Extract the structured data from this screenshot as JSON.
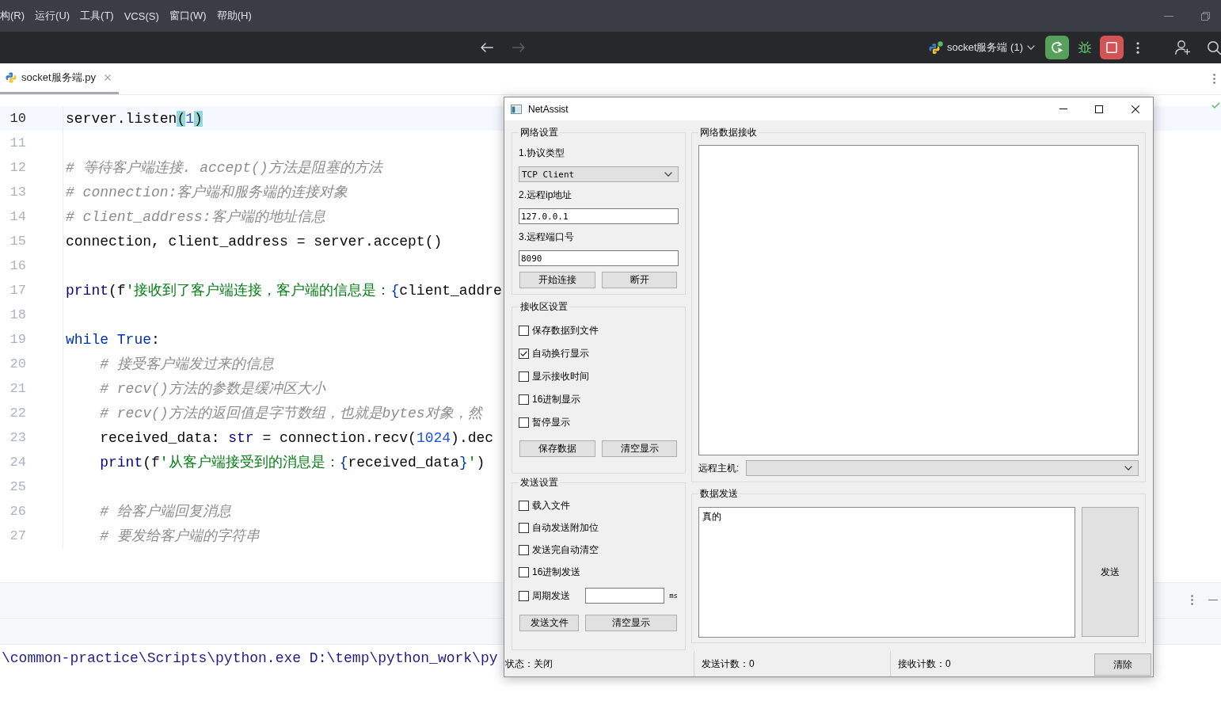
{
  "menu_bar": {
    "items": [
      "构(R)",
      "运行(U)",
      "工具(T)",
      "VCS(S)",
      "窗口(W)",
      "帮助(H)"
    ]
  },
  "toolbar": {
    "navigation": [
      {
        "kind": "back",
        "disabled": false
      },
      {
        "kind": "forward",
        "disabled": true
      }
    ],
    "run_configuration": "socket服务端 (1)"
  },
  "editor_tabs": [
    {
      "label": "socket服务端.py",
      "selected": true
    }
  ],
  "editor": {
    "lines": [
      {
        "number": "10",
        "current": true,
        "tokens": [
          {
            "kind": "code",
            "text": "server.listen"
          },
          {
            "kind": "matched_paren",
            "text": "("
          },
          {
            "kind": "number",
            "text": "1"
          },
          {
            "kind": "matched_paren",
            "text": ")"
          }
        ]
      },
      {
        "number": "11",
        "current": false
      },
      {
        "number": "12",
        "current": false,
        "tokens": [
          {
            "kind": "comment",
            "text": "# 等待客户端连接. accept()方法是阻塞的方法"
          }
        ]
      },
      {
        "number": "13",
        "current": false,
        "tokens": [
          {
            "kind": "comment",
            "text": "# connection:客户端和服务端的连接对象"
          }
        ]
      },
      {
        "number": "14",
        "current": false,
        "tokens": [
          {
            "kind": "comment",
            "text": "# client_address:客户端的地址信息"
          }
        ]
      },
      {
        "number": "15",
        "current": false,
        "tokens": [
          {
            "kind": "code",
            "text": "connection, client_address = server.accept()"
          }
        ]
      },
      {
        "number": "16",
        "current": false
      },
      {
        "number": "17",
        "current": false,
        "tokens": [
          {
            "kind": "builtin",
            "text": "print"
          },
          {
            "kind": "code",
            "text": "(f"
          },
          {
            "kind": "string",
            "text": "'接收到了客户端连接，客户端的信息是："
          },
          {
            "kind": "brace",
            "text": "{"
          },
          {
            "kind": "code",
            "text": "client_addre"
          }
        ]
      },
      {
        "number": "18",
        "current": false
      },
      {
        "number": "19",
        "current": false,
        "tokens": [
          {
            "kind": "keyword",
            "text": "while True"
          },
          {
            "kind": "code",
            "text": ":"
          }
        ],
        "children": [
          {
            "number": "20",
            "current": false,
            "tokens": [
              {
                "kind": "comment",
                "text": "# 接受客户端发过来的信息"
              }
            ]
          },
          {
            "number": "21",
            "current": false,
            "tokens": [
              {
                "kind": "comment",
                "text": "# recv()方法的参数是缓冲区大小"
              }
            ]
          },
          {
            "number": "22",
            "current": false,
            "tokens": [
              {
                "kind": "comment",
                "text": "# recv()方法的返回值是字节数组，也就是bytes对象，然"
              }
            ]
          },
          {
            "number": "23",
            "current": false,
            "tokens": [
              {
                "kind": "code",
                "text": "received_data: "
              },
              {
                "kind": "builtin",
                "text": "str"
              },
              {
                "kind": "code",
                "text": " = connection.recv("
              },
              {
                "kind": "number",
                "text": "1024"
              },
              {
                "kind": "code",
                "text": ").dec"
              }
            ]
          },
          {
            "number": "24",
            "current": false,
            "tokens": [
              {
                "kind": "builtin",
                "text": "print"
              },
              {
                "kind": "code",
                "text": "(f"
              },
              {
                "kind": "string",
                "text": "'从客户端接受到的消息是："
              },
              {
                "kind": "brace",
                "text": "{"
              },
              {
                "kind": "code",
                "text": "received_data"
              },
              {
                "kind": "brace",
                "text": "}"
              },
              {
                "kind": "string",
                "text": "'"
              },
              {
                "kind": "code",
                "text": ")"
              }
            ]
          },
          {
            "number": "25",
            "current": false
          },
          {
            "number": "26",
            "current": false,
            "tokens": [
              {
                "kind": "comment",
                "text": "# 给客户端回复消息"
              }
            ]
          },
          {
            "number": "27",
            "current": false,
            "tokens": [
              {
                "kind": "comment",
                "text": "# 要发给客户端的字符串"
              }
            ]
          }
        ]
      }
    ]
  },
  "console": {
    "lines": [
      "\\common-practice\\Scripts\\python.exe D:\\temp\\python_work\\py"
    ]
  },
  "netassist": {
    "title": "NetAssist",
    "network_settings": {
      "title": "网络设置",
      "fields": [
        {
          "kind": "select",
          "label": "1.协议类型",
          "value": "TCP Client"
        },
        {
          "kind": "text",
          "label": "2.远程ip地址",
          "value": "127.0.0.1"
        },
        {
          "kind": "text",
          "label": "3.远程端口号",
          "value": "8090"
        }
      ],
      "buttons": [
        "开始连接",
        "断开"
      ]
    },
    "receive_settings": {
      "title": "接收区设置",
      "options": [
        {
          "label": "保存数据到文件",
          "checked": false
        },
        {
          "label": "自动换行显示",
          "checked": true
        },
        {
          "label": "显示接收时间",
          "checked": false
        },
        {
          "label": "16进制显示",
          "checked": false
        },
        {
          "label": "暂停显示",
          "checked": false
        }
      ],
      "buttons": [
        "保存数据",
        "清空显示"
      ]
    },
    "send_settings": {
      "title": "发送设置",
      "options": [
        {
          "kind": "checkbox",
          "label": "载入文件",
          "checked": false
        },
        {
          "kind": "checkbox",
          "label": "自动发送附加位",
          "checked": false
        },
        {
          "kind": "checkbox",
          "label": "发送完自动清空",
          "checked": false
        },
        {
          "kind": "checkbox",
          "label": "16进制发送",
          "checked": false
        },
        {
          "kind": "interval",
          "label": "周期发送",
          "checked": false,
          "unit": "ms"
        }
      ],
      "buttons": [
        "发送文件",
        "清空显示"
      ]
    },
    "receive_area": {
      "title": "网络数据接收",
      "remote_host_label": "远程主机:"
    },
    "send_area": {
      "title": "数据发送",
      "value": "真的",
      "send_button": "发送"
    },
    "status_bar": {
      "state": "状态：关闭",
      "sent_count": "发送计数：0",
      "received_count": "接收计数：0",
      "clear_button": "清除"
    }
  }
}
